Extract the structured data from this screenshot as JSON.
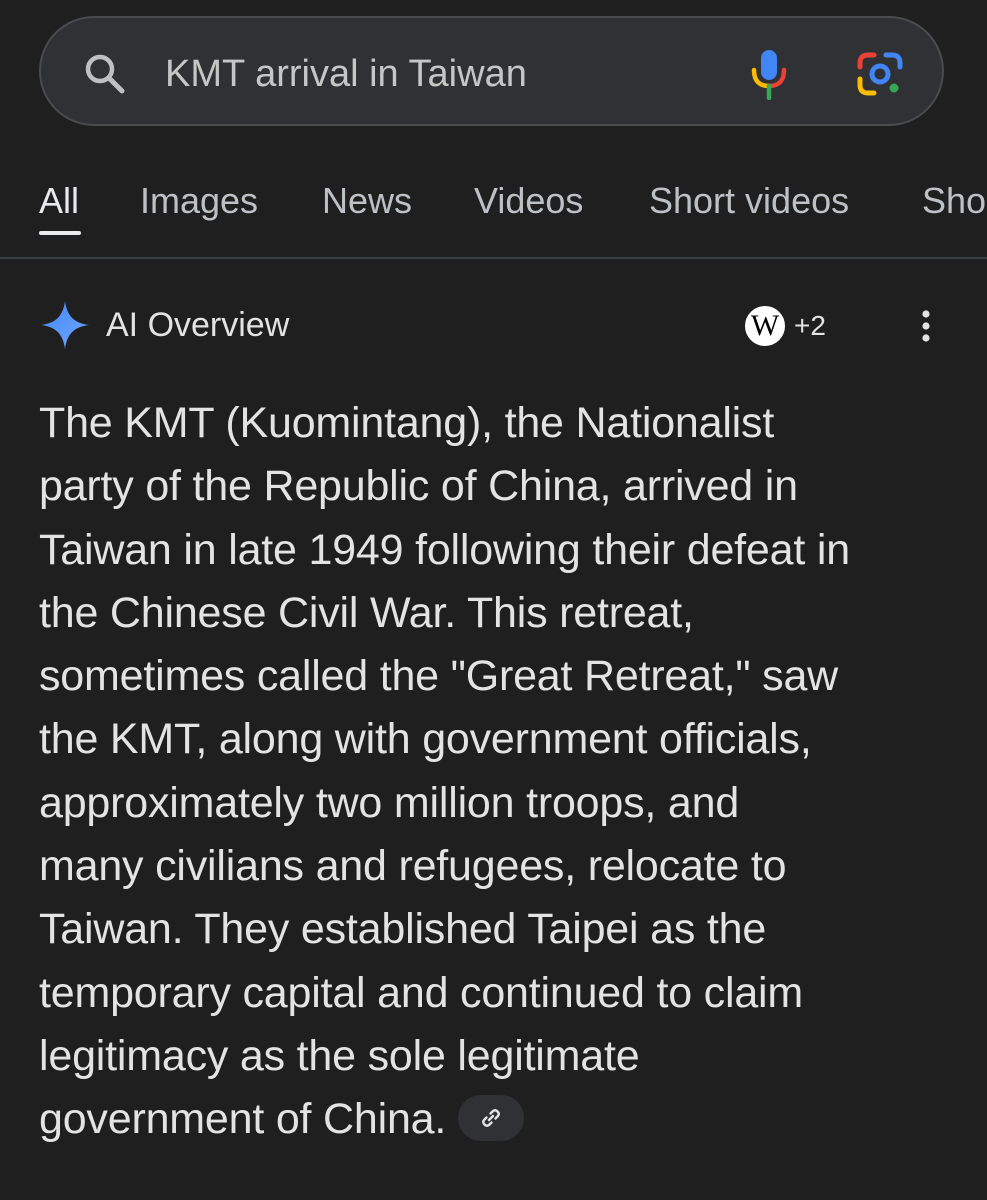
{
  "search": {
    "query": "KMT arrival in Taiwan",
    "icons": [
      "search-icon",
      "microphone-icon",
      "google-lens-icon"
    ]
  },
  "tabs": [
    {
      "label": "All",
      "active": true
    },
    {
      "label": "Images"
    },
    {
      "label": "News"
    },
    {
      "label": "Videos"
    },
    {
      "label": "Short videos"
    },
    {
      "label": "Sho"
    }
  ],
  "ai_overview": {
    "title": "AI Overview",
    "source_icon": "W",
    "source_count": "+2",
    "lines": [
      "The KMT (Kuomintang), the Nationalist",
      "party of the Republic of China, arrived in",
      "Taiwan in late 1949 following their defeat in",
      "the Chinese Civil War. This retreat,",
      "sometimes called the \"Great Retreat,\" saw",
      "the KMT, along with government officials,",
      "approximately two million troops, and",
      "many civilians and refugees, relocate to",
      "Taiwan. They established Taipei as the",
      "temporary capital and continued to claim",
      "legitimacy as the sole legitimate",
      "government of China."
    ]
  },
  "colors": {
    "background": "#1f1f1f",
    "search_bg": "#303134",
    "text": "#e3e3e3",
    "google_blue": "#4285f4",
    "google_red": "#ea4335",
    "google_yellow": "#fbbc04",
    "google_green": "#34a853"
  }
}
